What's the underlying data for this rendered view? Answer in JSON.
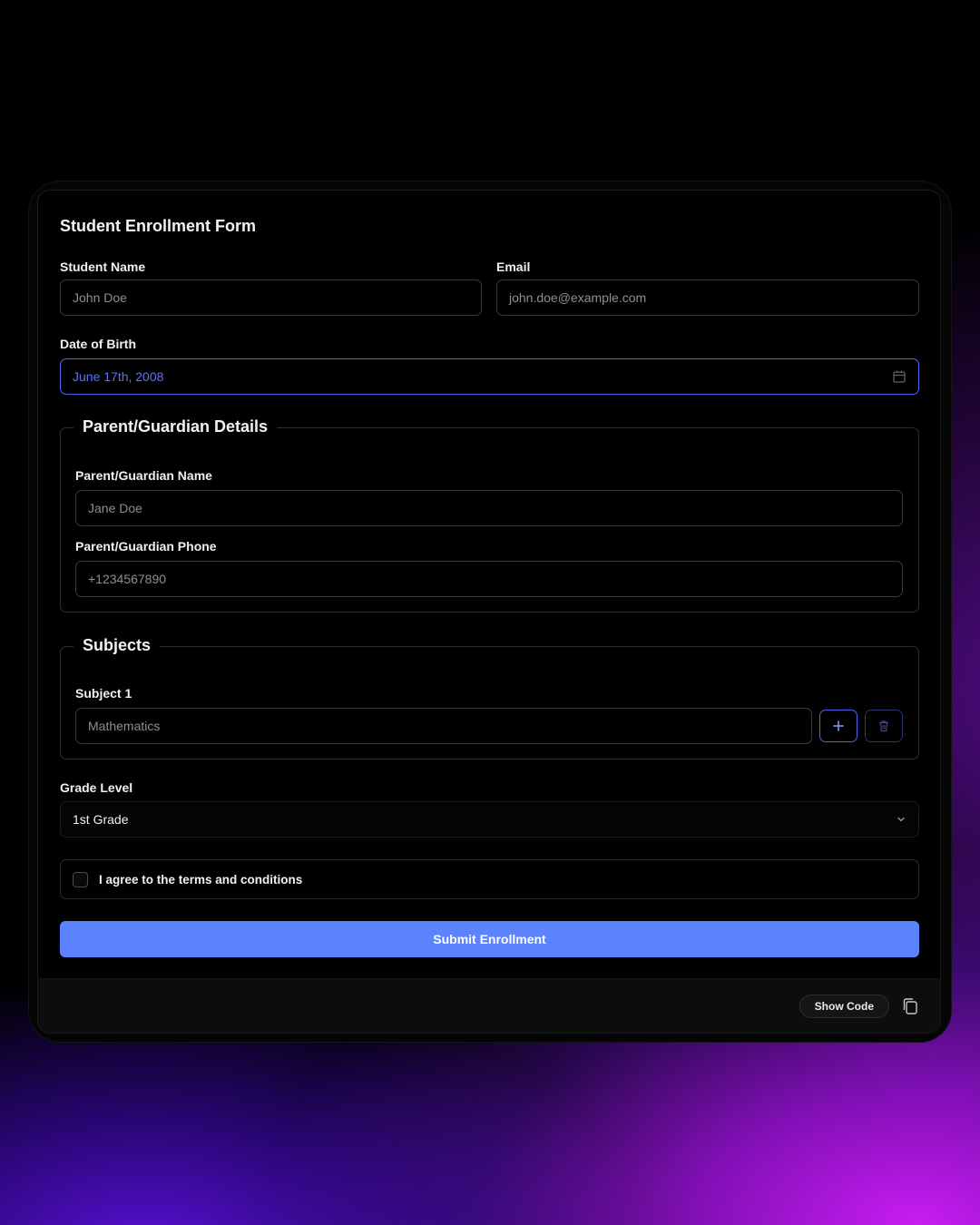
{
  "form": {
    "title": "Student Enrollment Form",
    "student_name": {
      "label": "Student Name",
      "placeholder": "John Doe"
    },
    "email": {
      "label": "Email",
      "placeholder": "john.doe@example.com"
    },
    "dob": {
      "label": "Date of Birth",
      "value": "June 17th, 2008",
      "icon": "calendar-icon"
    },
    "guardian": {
      "legend": "Parent/Guardian Details",
      "name": {
        "label": "Parent/Guardian Name",
        "placeholder": "Jane Doe"
      },
      "phone": {
        "label": "Parent/Guardian Phone",
        "placeholder": "+1234567890"
      }
    },
    "subjects": {
      "legend": "Subjects",
      "items": [
        {
          "label": "Subject 1",
          "placeholder": "Mathematics"
        }
      ],
      "add_icon": "plus-icon",
      "delete_icon": "trash-icon"
    },
    "grade": {
      "label": "Grade Level",
      "value": "1st Grade",
      "icon": "chevron-down-icon"
    },
    "terms": {
      "label": "I agree to the terms and conditions",
      "checked": false
    },
    "submit_label": "Submit Enrollment"
  },
  "footer": {
    "show_code_label": "Show Code",
    "copy_icon": "copy-icon"
  },
  "colors": {
    "accent": "#5b82ff",
    "focus_border": "#4e66f0",
    "background": "#000000",
    "gradient": "#c81cf2"
  }
}
